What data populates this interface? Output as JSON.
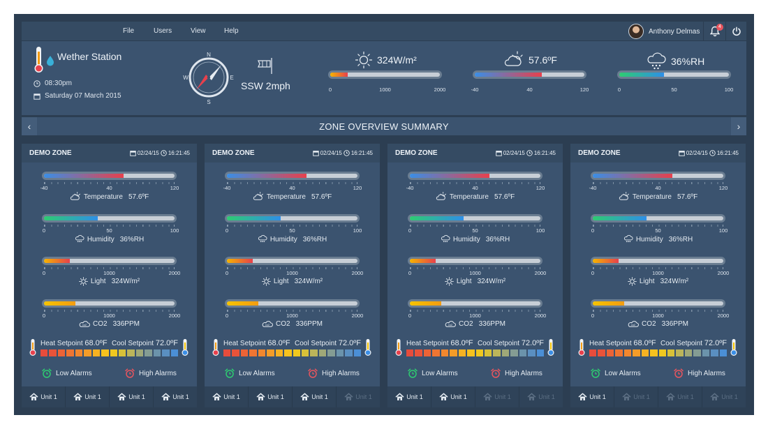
{
  "menu": [
    "File",
    "Users",
    "View",
    "Help"
  ],
  "user": {
    "name": "Anthony Delmas",
    "notifications": "4"
  },
  "station": {
    "title": "Wether Station",
    "time": "08:30pm",
    "date": "Saturday  07 March 2015"
  },
  "wind": {
    "text": "SSW 2mph",
    "compass_labels": {
      "n": "N",
      "s": "S",
      "e": "E",
      "w": "W"
    }
  },
  "stats": [
    {
      "id": "light",
      "icon": "sun-icon",
      "value": "324W/m²",
      "ticks": [
        "0",
        "1000",
        "2000"
      ],
      "level": 0.16,
      "gradient": "linear-gradient(90deg,#f5b400,#e8404c)"
    },
    {
      "id": "temperature",
      "icon": "partly-cloudy-icon",
      "value": "57.6ºF",
      "ticks": [
        "-40",
        "40",
        "120"
      ],
      "level": 0.61,
      "gradient": "linear-gradient(90deg,#3a8ee6,#e8404c)"
    },
    {
      "id": "humidity",
      "icon": "rain-cloud-icon",
      "value": "36%RH",
      "ticks": [
        "0",
        "50",
        "100"
      ],
      "level": 0.41,
      "gradient": "linear-gradient(90deg,#2ecc71,#2e8fe8)"
    }
  ],
  "title_bar": {
    "title": "ZONE OVERVIEW SUMMARY",
    "prev": "‹",
    "next": "›"
  },
  "zone_common": {
    "name": "DEMO ZONE",
    "date": "02/24/15",
    "time": "16:21:45",
    "sensors": [
      {
        "id": "temperature",
        "icon": "partly-cloudy-icon",
        "label": "Temperature",
        "value": "57.6ºF",
        "ticks": [
          "-40",
          "40",
          "120"
        ],
        "level": 0.61,
        "gradient": "linear-gradient(90deg,#3a8ee6,#e8404c)"
      },
      {
        "id": "humidity",
        "icon": "rain-cloud-icon",
        "label": "Humidity",
        "value": "36%RH",
        "ticks": [
          "0",
          "50",
          "100"
        ],
        "level": 0.41,
        "gradient": "linear-gradient(90deg,#2ecc71,#2e8fe8)"
      },
      {
        "id": "light",
        "icon": "sun-icon",
        "label": "Light",
        "value": "324W/m²",
        "ticks": [
          "0",
          "1000",
          "2000"
        ],
        "level": 0.2,
        "gradient": "linear-gradient(90deg,#f5b400,#e8404c)"
      },
      {
        "id": "co2",
        "icon": "co2-cloud-icon",
        "label": "CO2",
        "value": "336PPM",
        "ticks": [
          "0",
          "1000",
          "2000"
        ],
        "level": 0.24,
        "gradient": "linear-gradient(90deg,#f5c400,#f39c12)"
      }
    ],
    "heat_label": "Heat Setpoint",
    "heat_value": "68.0ºF",
    "cool_label": "Cool Setpoint",
    "cool_value": "72.0ºF",
    "swatch_colors": [
      "#e74c3c",
      "#e9533a",
      "#ec6336",
      "#ef7532",
      "#f2872e",
      "#f49c28",
      "#f6b222",
      "#f7c21e",
      "#f0c81f",
      "#d8c138",
      "#bcb55a",
      "#9fa878",
      "#849c93",
      "#6b93ab",
      "#5a8fc1",
      "#4b8fd6"
    ],
    "low_alarms": "Low Alarms",
    "high_alarms": "High Alarms",
    "unit_label": "Unit 1"
  },
  "zones": [
    {
      "units_active": [
        true,
        true,
        true,
        true
      ]
    },
    {
      "units_active": [
        true,
        true,
        true,
        false
      ]
    },
    {
      "units_active": [
        true,
        true,
        false,
        false
      ]
    },
    {
      "units_active": [
        true,
        false,
        false,
        false
      ]
    }
  ],
  "colors": {
    "background": "#2c3e52",
    "panel": "#3b536f",
    "alarm_low": "#2ecc71",
    "alarm_high": "#e8555e"
  }
}
